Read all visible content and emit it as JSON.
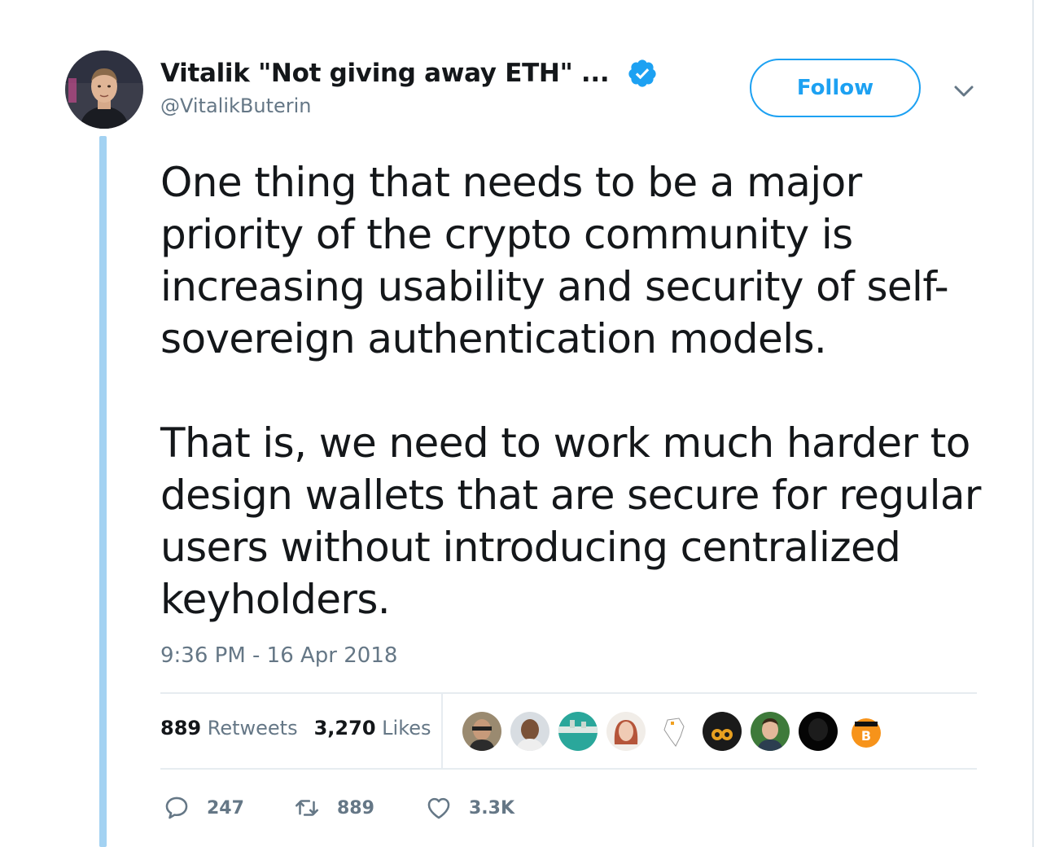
{
  "tweet": {
    "author": {
      "display_name": "Vitalik \"Not giving away ETH\" ...",
      "handle": "@VitalikButerin",
      "verified": true
    },
    "follow_label": "Follow",
    "paragraphs": [
      [
        "One thing that needs to be a major",
        "priority of the crypto community is",
        "increasing usability and security of self-",
        "sovereign authentication models."
      ],
      [
        "That is, we need to work much harder to",
        "design wallets that are secure for regular",
        "users without introducing centralized",
        "keyholders."
      ]
    ],
    "timestamp": "9:36 PM - 16 Apr 2018",
    "stats": {
      "retweets_count": "889",
      "retweets_label": "Retweets",
      "likes_count": "3,270",
      "likes_label": "Likes"
    },
    "liker_avatars": [
      "liker-avatar-1",
      "liker-avatar-2",
      "liker-avatar-3",
      "liker-avatar-4",
      "liker-avatar-5",
      "liker-avatar-6",
      "liker-avatar-7",
      "liker-avatar-8",
      "liker-avatar-9"
    ],
    "actions": {
      "reply_count": "247",
      "retweet_count": "889",
      "like_count": "3.3K"
    }
  },
  "colors": {
    "accent": "#1da1f2",
    "thread_line": "#a3d2f2",
    "secondary_text": "#657786",
    "primary_text": "#14171a"
  },
  "icons": {
    "verified": "verified-badge-icon",
    "caret": "chevron-down-icon",
    "reply": "reply-icon",
    "retweet": "retweet-icon",
    "like": "heart-icon"
  }
}
